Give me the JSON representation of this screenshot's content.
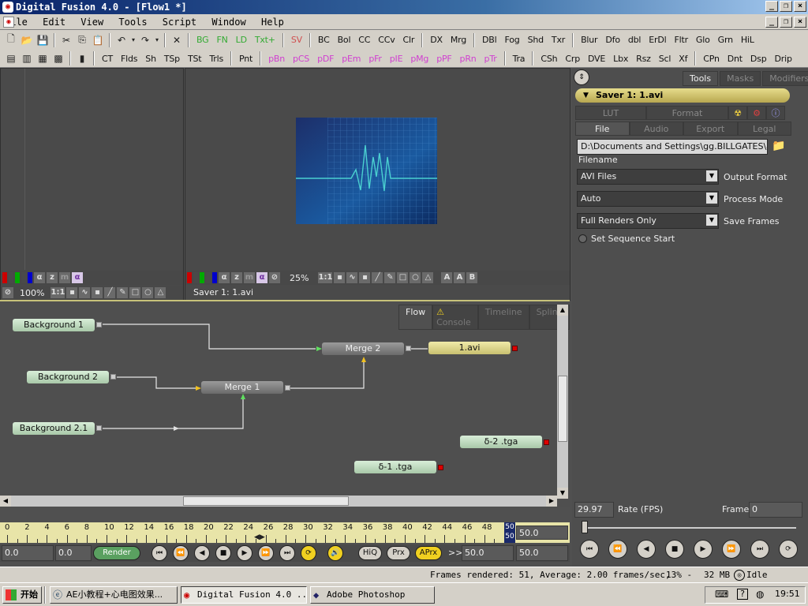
{
  "window": {
    "title": "Digital Fusion 4.0 - [Flow1 *]"
  },
  "menu": [
    "File",
    "Edit",
    "View",
    "Tools",
    "Script",
    "Window",
    "Help"
  ],
  "toolbar1": {
    "tools": [
      "BG",
      "FN",
      "LD",
      "Txt+",
      "SV",
      "BC",
      "Bol",
      "CC",
      "CCv",
      "Clr",
      "DX",
      "Mrg",
      "DBl",
      "Fog",
      "Shd",
      "Txr",
      "Blur",
      "Dfo",
      "dbl",
      "ErDl",
      "Fltr",
      "Glo",
      "Grn",
      "HiL"
    ]
  },
  "toolbar2": {
    "tools": [
      "CT",
      "Flds",
      "Sh",
      "TSp",
      "TSt",
      "Trls",
      "Pnt",
      "pBn",
      "pCS",
      "pDF",
      "pEm",
      "pFr",
      "pIE",
      "pMg",
      "pPF",
      "pRn",
      "pTr",
      "Tra",
      "CSh",
      "Crp",
      "DVE",
      "Lbx",
      "Rsz",
      "Scl",
      "Xf",
      "CPn",
      "Dnt",
      "Dsp",
      "Drip"
    ]
  },
  "viewer_left": {
    "zoom": "100%",
    "scale_label": "1:1"
  },
  "viewer_right": {
    "zoom": "25%",
    "scale_label": "1:1",
    "caption": "Saver 1: 1.avi"
  },
  "inspector": {
    "tabs": [
      "Tools",
      "Masks",
      "Modifiers"
    ],
    "tool_title": "Saver 1: 1.avi",
    "row1": [
      "LUT",
      "Format"
    ],
    "row2": [
      "File",
      "Audio",
      "Export",
      "Legal"
    ],
    "filename_value": "D:\\Documents and Settings\\gg.BILLGATES\\桌面\\",
    "filename_label": "Filename",
    "output_format_value": "AVI Files",
    "output_format_label": "Output Format",
    "process_mode_value": "Auto",
    "process_mode_label": "Process Mode",
    "save_frames_value": "Full Renders Only",
    "save_frames_label": "Save Frames",
    "sequence_label": "Set Sequence Start"
  },
  "flow": {
    "tabs": [
      "Flow",
      "Console",
      "Timeline",
      "Spline"
    ],
    "nodes": {
      "bg1": "Background 1",
      "bg2": "Background 2",
      "bg21": "Background 2.1",
      "merge1": "Merge 1",
      "merge2": "Merge 2",
      "saver": "1.avi",
      "tga2": "δ-2 .tga",
      "tga1": "δ-1 .tga"
    }
  },
  "timeline": {
    "ticks": [
      "0",
      "2",
      "4",
      "6",
      "8",
      "10",
      "12",
      "14",
      "16",
      "18",
      "20",
      "22",
      "24",
      "26",
      "28",
      "30",
      "32",
      "34",
      "36",
      "38",
      "40",
      "42",
      "44",
      "46",
      "48"
    ],
    "end_top": "50",
    "end_bottom": "50",
    "end_value": "50.0"
  },
  "transport": {
    "start_value": "0.0",
    "current_value": "0.0",
    "render_label": "Render",
    "hiq_label": "HiQ",
    "prx_label": "Prx",
    "aprx_label": "APrx",
    "range_start": "50.0",
    "range_end": "50.0",
    "chevrons": ">>"
  },
  "right_transport": {
    "rate_value": "29.97",
    "rate_label": "Rate (FPS)",
    "frame_label": "Frame",
    "frame_value": "0"
  },
  "status": {
    "frames_text": "Frames rendered: 51,  Average: 2.00 frames/sec,",
    "percent": "13% -",
    "memory": "32 MB",
    "state": "Idle"
  },
  "taskbar": {
    "start": "开始",
    "items": [
      "AE小教程+心电图效果...",
      "Digital Fusion 4.0 ...",
      "Adobe Photoshop"
    ],
    "clock": "19:51"
  },
  "colors": {
    "title_bar": "#0a246a",
    "flow_border": "#c8c27a",
    "saver_node": "#f0eaa8",
    "merge_node": "#7a7a7a",
    "background_node": "#c4e0c4",
    "ecg_line": "#4ad0d0"
  }
}
